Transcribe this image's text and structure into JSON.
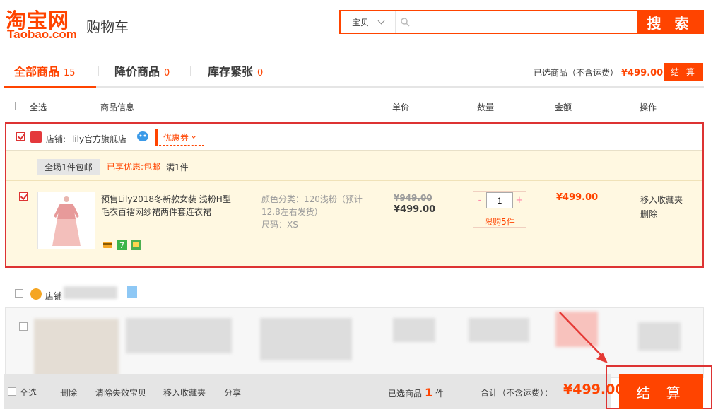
{
  "header": {
    "logo_cn": "淘宝网",
    "logo_en": "Taobao.com",
    "page_title": "购物车"
  },
  "search": {
    "scope": "宝贝",
    "placeholder": "",
    "button": "搜 索"
  },
  "tabs": [
    {
      "label": "全部商品",
      "count": "15"
    },
    {
      "label": "降价商品",
      "count": "0"
    },
    {
      "label": "库存紧张",
      "count": "0"
    }
  ],
  "summary_top": {
    "label": "已选商品（不含运费）",
    "amount": "¥499.00",
    "button": "结 算"
  },
  "columns": {
    "select_all": "全选",
    "info": "商品信息",
    "price": "单价",
    "qty": "数量",
    "amount": "金额",
    "ops": "操作"
  },
  "shop1": {
    "label": "店铺:",
    "name": "lily官方旗舰店",
    "coupon": "优惠券",
    "promo_tag": "全场1件包邮",
    "promo_enjoyed": "已享优惠:包邮",
    "promo_cond": "满1件"
  },
  "item1": {
    "title": "预售Lily2018冬新款女装 浅粉H型毛衣百褶网纱裙两件套连衣裙",
    "sku_color": "颜色分类：120浅粉（预计12.8左右发货）",
    "sku_size": "尺码：XS",
    "price_old": "¥949.00",
    "price_new": "¥499.00",
    "qty_minus": "-",
    "qty": "1",
    "qty_plus": "+",
    "qty_limit": "限购5件",
    "amount": "¥499.00",
    "fav": "移入收藏夹",
    "delete": "删除"
  },
  "shop2": {
    "label": "店铺"
  },
  "footer": {
    "select_all": "全选",
    "delete": "删除",
    "clear_invalid": "清除失效宝贝",
    "move_fav": "移入收藏夹",
    "share": "分享",
    "selected_label": "已选商品",
    "selected_count": "1",
    "selected_unit": "件",
    "total_label": "合计（不含运费）：",
    "total": "¥499.00",
    "checkout": "结 算"
  },
  "colors": {
    "accent": "#ff4400",
    "highlight_border": "#dd3333",
    "item_bg": "#fff8e1"
  }
}
